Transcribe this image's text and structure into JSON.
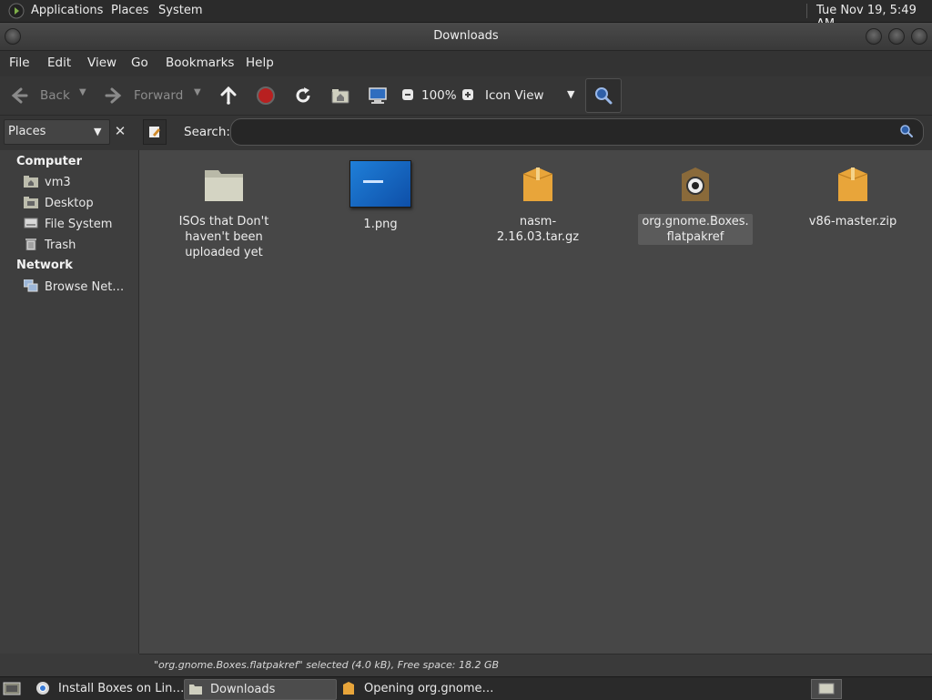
{
  "top_panel": {
    "menus": [
      "Applications",
      "Places",
      "System"
    ],
    "clock": "Tue Nov 19,  5:49 AM"
  },
  "window": {
    "title": "Downloads"
  },
  "menubar": [
    "File",
    "Edit",
    "View",
    "Go",
    "Bookmarks",
    "Help"
  ],
  "toolbar": {
    "back_label": "Back",
    "forward_label": "Forward",
    "zoom": "100%",
    "view_mode": "Icon View"
  },
  "location": {
    "sidebar_mode": "Places",
    "search_label": "Search:",
    "search_value": ""
  },
  "sidebar": {
    "computer_heading": "Computer",
    "computer_items": [
      "vm3",
      "Desktop",
      "File System",
      "Trash"
    ],
    "network_heading": "Network",
    "network_items": [
      "Browse Net…"
    ]
  },
  "files": [
    {
      "name": "ISOs that Don't haven't been uploaded yet",
      "lines": [
        "ISOs that Don't",
        "haven't been",
        "uploaded yet"
      ],
      "icon": "folder-icon"
    },
    {
      "name": "1.png",
      "lines": [
        "1.png"
      ],
      "icon": "image-thumbnail"
    },
    {
      "name": "nasm-2.16.03.tar.gz",
      "lines": [
        "nasm-2.16.03.tar.gz"
      ],
      "icon": "archive-icon"
    },
    {
      "name": "org.gnome.Boxes.flatpakref",
      "lines": [
        "org.gnome.Boxes.",
        "flatpakref"
      ],
      "icon": "package-icon",
      "selected": true
    },
    {
      "name": "v86-master.zip",
      "lines": [
        "v86-master.zip"
      ],
      "icon": "archive-icon"
    }
  ],
  "status": "\"org.gnome.Boxes.flatpakref\" selected (4.0 kB), Free space: 18.2 GB",
  "taskbar": {
    "tasks": [
      "Install Boxes on Lin…",
      "Downloads",
      "Opening org.gnome…"
    ]
  }
}
